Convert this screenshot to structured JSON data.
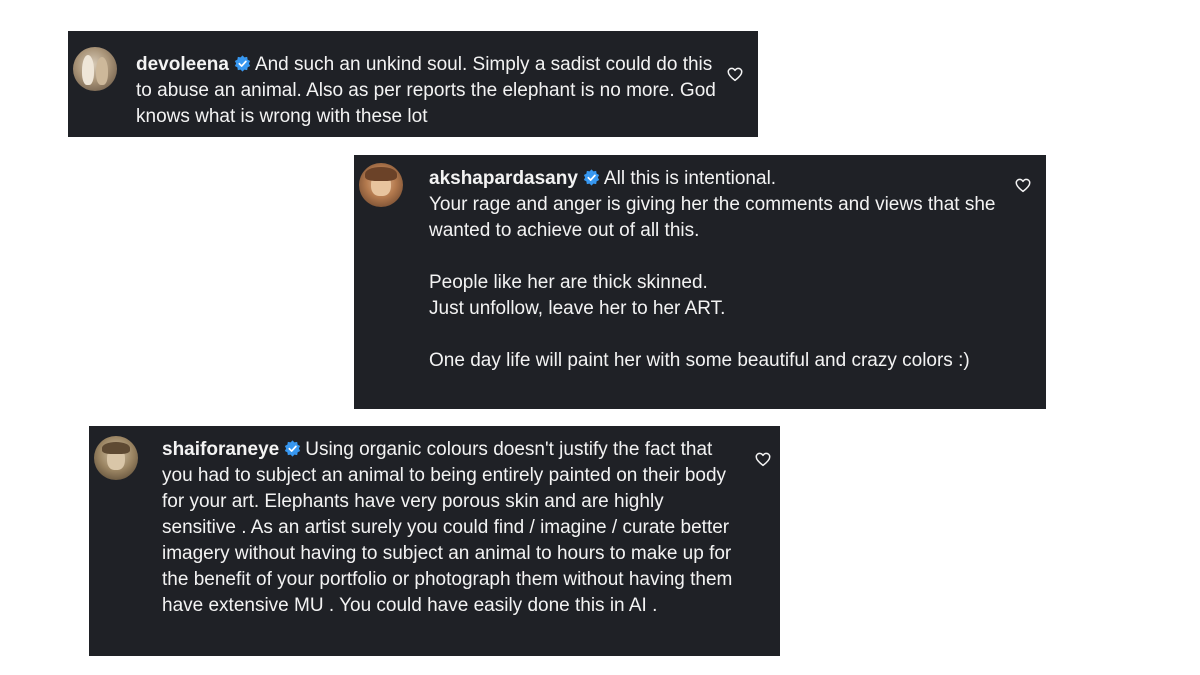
{
  "comments": [
    {
      "username": "devoleena",
      "verified": true,
      "text": "And such an unkind soul. Simply a sadist could do this to abuse an animal. Also as per reports the elephant is no more. God knows what is wrong with these lot",
      "icons": {
        "avatar": "avatar-photo",
        "verified": "verified-badge-icon",
        "like": "heart-outline-icon"
      }
    },
    {
      "username": "akshapardasany",
      "verified": true,
      "text": "All this is intentional.\nYour rage and anger is giving her the comments and views that she wanted to achieve out of all this.\n\nPeople like her are thick skinned.\nJust unfollow, leave her to her ART.\n\nOne day life will paint her with some beautiful and crazy colors :)",
      "icons": {
        "avatar": "avatar-photo",
        "verified": "verified-badge-icon",
        "like": "heart-outline-icon"
      }
    },
    {
      "username": "shaiforaneye",
      "verified": true,
      "text": "Using organic colours doesn't justify the fact that you had to subject an animal to being entirely painted on their body for your art. Elephants have very porous skin and are highly sensitive . As an artist surely you could find / imagine / curate better imagery without having to subject an animal to hours to make up for the benefit of your portfolio or photograph them without having them have extensive MU . You could have easily done this in AI .",
      "icons": {
        "avatar": "avatar-photo",
        "verified": "verified-badge-icon",
        "like": "heart-outline-icon"
      }
    }
  ],
  "colors": {
    "card_background": "#1f2126",
    "text": "#f3f3f3",
    "verified_badge": "#3797f0",
    "page_background": "#ffffff"
  }
}
